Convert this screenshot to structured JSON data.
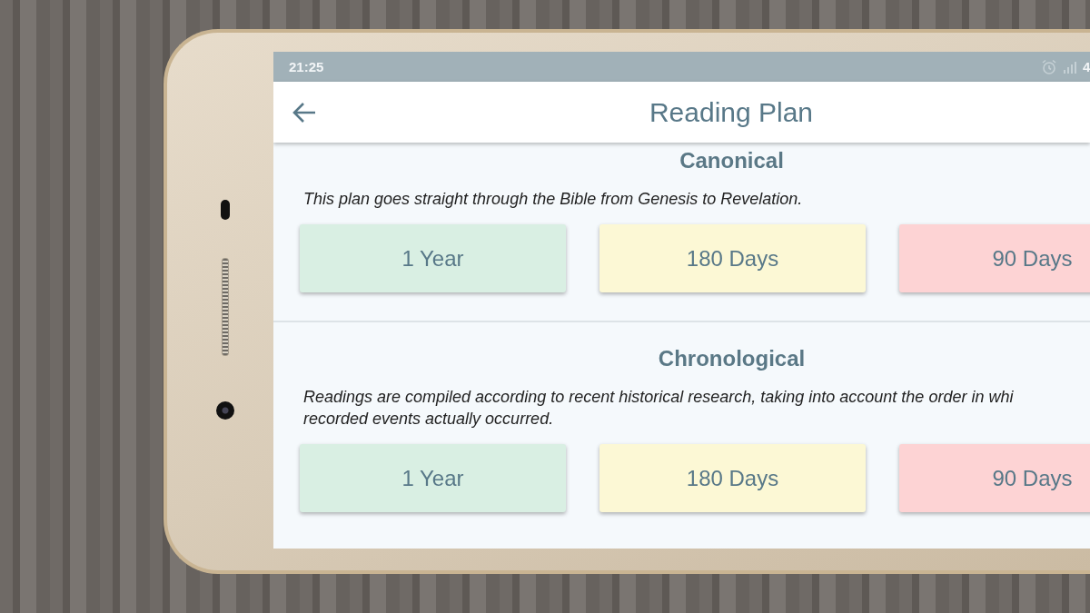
{
  "status_bar": {
    "time": "21:25",
    "battery_text": "4"
  },
  "header": {
    "title": "Reading Plan"
  },
  "sections": [
    {
      "title": "Canonical",
      "description_lines": [
        "This plan goes straight through the Bible from Genesis to Revelation."
      ],
      "plans": [
        {
          "label": "1 Year",
          "color": "#d9efe3"
        },
        {
          "label": "180 Days",
          "color": "#fcf8d5"
        },
        {
          "label": "90 Days",
          "color": "#fdd3d4"
        }
      ]
    },
    {
      "title": "Chronological",
      "description_lines": [
        "Readings are compiled according to recent historical research, taking into account the order in whi",
        "recorded events actually occurred."
      ],
      "plans": [
        {
          "label": "1 Year",
          "color": "#d9efe3"
        },
        {
          "label": "180 Days",
          "color": "#fcf8d5"
        },
        {
          "label": "90 Days",
          "color": "#fdd3d4"
        }
      ]
    }
  ]
}
